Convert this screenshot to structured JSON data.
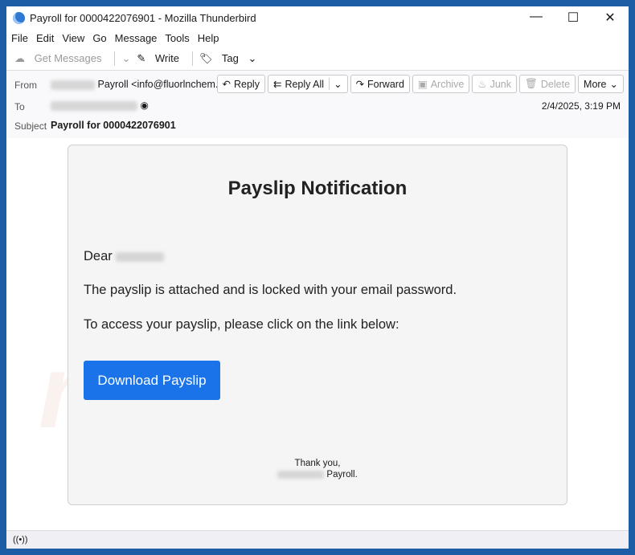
{
  "window": {
    "title": "Payroll for 0000422076901 - Mozilla Thunderbird",
    "controls": [
      "—",
      "☐",
      "✕"
    ]
  },
  "menu": [
    "File",
    "Edit",
    "View",
    "Go",
    "Message",
    "Tools",
    "Help"
  ],
  "toolbar": {
    "get_messages": "Get Messages",
    "write": "Write",
    "tag": "Tag"
  },
  "header": {
    "from_label": "From",
    "from_value": "Payroll <info@fluorlnchem.com>",
    "to_label": "To",
    "subject_label": "Subject",
    "subject": "Payroll for 0000422076901",
    "date": "2/4/2025, 3:19 PM",
    "buttons": {
      "reply": "Reply",
      "reply_all": "Reply All",
      "forward": "Forward",
      "archive": "Archive",
      "junk": "Junk",
      "delete": "Delete",
      "more": "More"
    }
  },
  "email": {
    "title": "Payslip Notification",
    "greeting": "Dear",
    "line1": "The payslip is attached and is locked with your email password.",
    "line2": "To access your payslip, please click on the link below:",
    "button": "Download Payslip",
    "closing": "Thank you,",
    "signature": "Payroll."
  },
  "watermark": "risk.com"
}
